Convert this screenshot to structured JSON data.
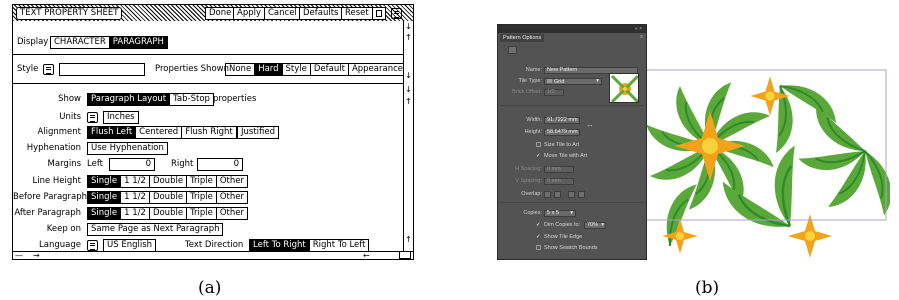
{
  "left": {
    "title": "TEXT PROPERTY SHEET",
    "title_buttons": [
      "Done",
      "Apply",
      "Cancel",
      "Defaults",
      "Reset"
    ],
    "display_label": "Display",
    "display_tabs": [
      "CHARACTER",
      "PARAGRAPH"
    ],
    "style_label": "Style",
    "properties_shown_label": "Properties Shown",
    "properties_shown": [
      "None",
      "Hard",
      "Style",
      "Default",
      "Appearance"
    ],
    "show_label": "Show",
    "show_options": [
      "Paragraph Layout",
      "Tab-Stop"
    ],
    "show_suffix": "properties",
    "units_label": "Units",
    "units_value": "Inches",
    "alignment_label": "Alignment",
    "alignment_options": [
      "Flush Left",
      "Centered",
      "Flush Right"
    ],
    "justified": "Justified",
    "hyphenation_label": "Hyphenation",
    "hyphenation_value": "Use Hyphenation",
    "margins_label": "Margins",
    "left_label": "Left",
    "left_value": "0",
    "right_label": "Right",
    "right_value": "0",
    "line_height_label": "Line Height",
    "before_paragraph_label": "Before Paragraph",
    "after_paragraph_label": "After Paragraph",
    "spacing_options": [
      "Single",
      "1 1/2",
      "Double",
      "Triple",
      "Other"
    ],
    "keep_on_label": "Keep on",
    "keep_on_value": "Same Page as Next Paragraph",
    "language_label": "Language",
    "language_value": "US English",
    "text_direction_label": "Text Direction",
    "text_direction_options": [
      "Left To Right",
      "Right To Left"
    ]
  },
  "right": {
    "panel_title": "Pattern Options",
    "name_label": "Name:",
    "name_value": "New Pattern",
    "tile_type_label": "Tile Type:",
    "tile_type_value": "Grid",
    "brick_offset_label": "Brick Offset:",
    "brick_offset_value": "1/2",
    "width_label": "Width:",
    "width_value": "91.7222 mm",
    "height_label": "Height:",
    "height_value": "58.6479 mm",
    "size_tile_to_art": "Size Tile to Art",
    "move_tile_with_art": "Move Tile with Art",
    "h_spacing_label": "H Spacing:",
    "h_spacing_value": "0 mm",
    "v_spacing_label": "V Spacing:",
    "v_spacing_value": "0 mm",
    "overlap_label": "Overlap:",
    "copies_label": "Copies:",
    "copies_value": "5 x 5",
    "dim_copies_label": "Dim Copies to:",
    "dim_copies_value": "70%",
    "show_tile_edge": "Show Tile Edge",
    "show_swatch_bounds": "Show Swatch Bounds",
    "colors": {
      "panel_bg": "#535353",
      "leaf_green": "#5aa83a",
      "dark_green": "#2f8a2a",
      "flower_orange": "#f5a21b",
      "flower_yellow": "#f8d23a"
    }
  },
  "captions": [
    "(a)",
    "(b)"
  ]
}
